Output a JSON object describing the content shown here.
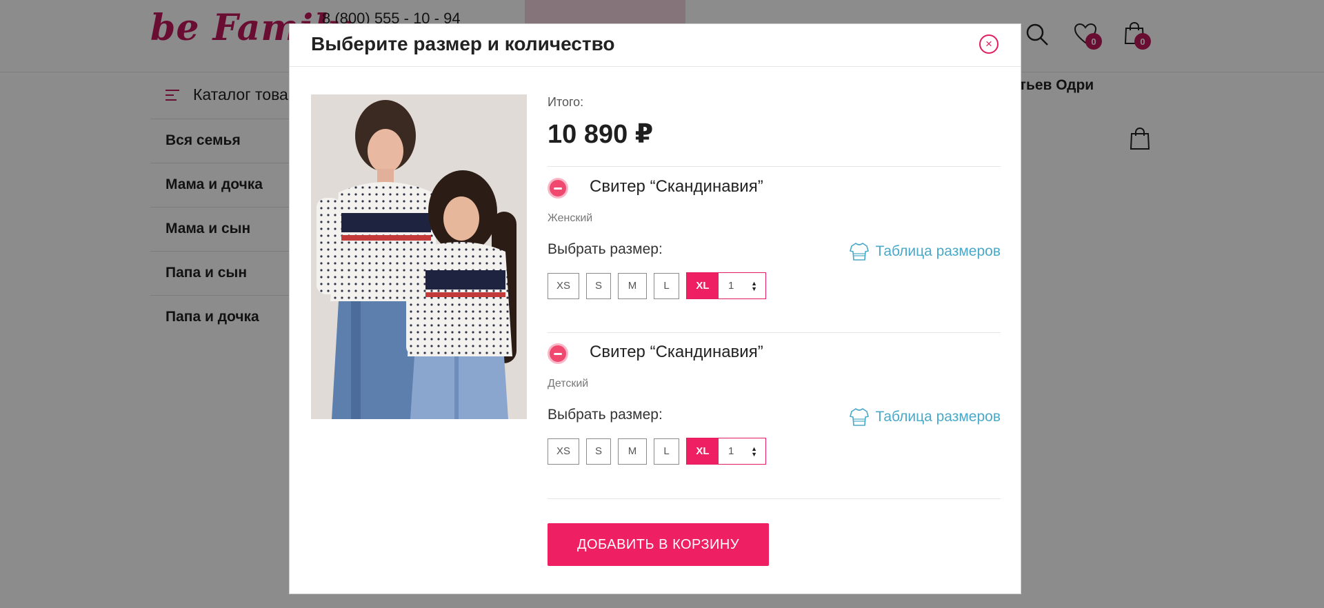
{
  "header": {
    "logo_text": "be Family",
    "phone": "8 (800) 555 - 10 - 94",
    "wishlist_count": "0",
    "cart_count": "0"
  },
  "catalog": {
    "label": "Каталог товаров",
    "promo_text": "атьев Одри"
  },
  "side_menu": {
    "items": [
      {
        "label": "Вся семья"
      },
      {
        "label": "Мама и дочка"
      },
      {
        "label": "Мама и сын"
      },
      {
        "label": "Папа и сын"
      },
      {
        "label": "Папа и дочка"
      }
    ]
  },
  "modal": {
    "title": "Выберите размер и количество",
    "close_icon": "×",
    "total_label": "Итого:",
    "total_value": "10 890 ₽",
    "size_table_label": "Таблица размеров",
    "size_label": "Выбрать размер:",
    "add_to_cart_label": "ДОБАВИТЬ В КОРЗИНУ",
    "items": [
      {
        "name": "Свитер “Скандинавия”",
        "subtitle": "Женский",
        "sizes": [
          "XS",
          "S",
          "M",
          "L"
        ],
        "selected_size": "XL",
        "quantity": "1"
      },
      {
        "name": "Свитер “Скандинавия”",
        "subtitle": "Детский",
        "sizes": [
          "XS",
          "S",
          "M",
          "L"
        ],
        "selected_size": "XL",
        "quantity": "1"
      }
    ]
  },
  "colors": {
    "accent": "#ee1f63",
    "link": "#4aa8c8",
    "brand": "#c2185b"
  },
  "icons": {
    "search": "search-icon",
    "wishlist": "heart-icon",
    "cart": "shopping-bag-icon",
    "close": "close-icon",
    "remove": "minus-circle-icon",
    "size_table": "sweater-icon",
    "menu": "burger-icon"
  }
}
